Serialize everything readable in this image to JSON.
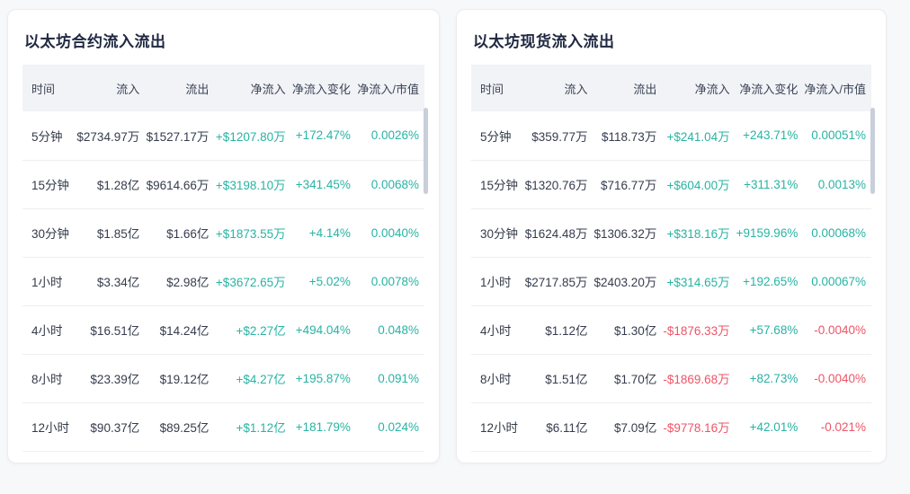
{
  "colors": {
    "positive": "#29b3a4",
    "negative": "#ee5467"
  },
  "tables": {
    "contract": {
      "title": "以太坊合约流入流出",
      "headers": {
        "time": "时间",
        "inflow": "流入",
        "outflow": "流出",
        "net": "净流入",
        "net_change": "净流入变化",
        "net_mcap": "净流入/市值"
      },
      "rows": [
        {
          "time": "5分钟",
          "inflow": "$2734.97万",
          "outflow": "$1527.17万",
          "net": "+$1207.80万",
          "net_class": "pos",
          "net_change": "+172.47%",
          "net_change_class": "pos",
          "net_mcap": "0.0026%",
          "net_mcap_class": "pos"
        },
        {
          "time": "15分钟",
          "inflow": "$1.28亿",
          "outflow": "$9614.66万",
          "net": "+$3198.10万",
          "net_class": "pos",
          "net_change": "+341.45%",
          "net_change_class": "pos",
          "net_mcap": "0.0068%",
          "net_mcap_class": "pos"
        },
        {
          "time": "30分钟",
          "inflow": "$1.85亿",
          "outflow": "$1.66亿",
          "net": "+$1873.55万",
          "net_class": "pos",
          "net_change": "+4.14%",
          "net_change_class": "pos",
          "net_mcap": "0.0040%",
          "net_mcap_class": "pos"
        },
        {
          "time": "1小时",
          "inflow": "$3.34亿",
          "outflow": "$2.98亿",
          "net": "+$3672.65万",
          "net_class": "pos",
          "net_change": "+5.02%",
          "net_change_class": "pos",
          "net_mcap": "0.0078%",
          "net_mcap_class": "pos"
        },
        {
          "time": "4小时",
          "inflow": "$16.51亿",
          "outflow": "$14.24亿",
          "net": "+$2.27亿",
          "net_class": "pos",
          "net_change": "+494.04%",
          "net_change_class": "pos",
          "net_mcap": "0.048%",
          "net_mcap_class": "pos"
        },
        {
          "time": "8小时",
          "inflow": "$23.39亿",
          "outflow": "$19.12亿",
          "net": "+$4.27亿",
          "net_class": "pos",
          "net_change": "+195.87%",
          "net_change_class": "pos",
          "net_mcap": "0.091%",
          "net_mcap_class": "pos"
        },
        {
          "time": "12小时",
          "inflow": "$90.37亿",
          "outflow": "$89.25亿",
          "net": "+$1.12亿",
          "net_class": "pos",
          "net_change": "+181.79%",
          "net_change_class": "pos",
          "net_mcap": "0.024%",
          "net_mcap_class": "pos"
        }
      ]
    },
    "spot": {
      "title": "以太坊现货流入流出",
      "headers": {
        "time": "时间",
        "inflow": "流入",
        "outflow": "流出",
        "net": "净流入",
        "net_change": "净流入变化",
        "net_mcap": "净流入/市值"
      },
      "rows": [
        {
          "time": "5分钟",
          "inflow": "$359.77万",
          "outflow": "$118.73万",
          "net": "+$241.04万",
          "net_class": "pos",
          "net_change": "+243.71%",
          "net_change_class": "pos",
          "net_mcap": "0.00051%",
          "net_mcap_class": "pos"
        },
        {
          "time": "15分钟",
          "inflow": "$1320.76万",
          "outflow": "$716.77万",
          "net": "+$604.00万",
          "net_class": "pos",
          "net_change": "+311.31%",
          "net_change_class": "pos",
          "net_mcap": "0.0013%",
          "net_mcap_class": "pos"
        },
        {
          "time": "30分钟",
          "inflow": "$1624.48万",
          "outflow": "$1306.32万",
          "net": "+$318.16万",
          "net_class": "pos",
          "net_change": "+9159.96%",
          "net_change_class": "pos",
          "net_mcap": "0.00068%",
          "net_mcap_class": "pos"
        },
        {
          "time": "1小时",
          "inflow": "$2717.85万",
          "outflow": "$2403.20万",
          "net": "+$314.65万",
          "net_class": "pos",
          "net_change": "+192.65%",
          "net_change_class": "pos",
          "net_mcap": "0.00067%",
          "net_mcap_class": "pos"
        },
        {
          "time": "4小时",
          "inflow": "$1.12亿",
          "outflow": "$1.30亿",
          "net": "-$1876.33万",
          "net_class": "neg",
          "net_change": "+57.68%",
          "net_change_class": "pos",
          "net_mcap": "-0.0040%",
          "net_mcap_class": "neg"
        },
        {
          "time": "8小时",
          "inflow": "$1.51亿",
          "outflow": "$1.70亿",
          "net": "-$1869.68万",
          "net_class": "neg",
          "net_change": "+82.73%",
          "net_change_class": "pos",
          "net_mcap": "-0.0040%",
          "net_mcap_class": "neg"
        },
        {
          "time": "12小时",
          "inflow": "$6.11亿",
          "outflow": "$7.09亿",
          "net": "-$9778.16万",
          "net_class": "neg",
          "net_change": "+42.01%",
          "net_change_class": "pos",
          "net_mcap": "-0.021%",
          "net_mcap_class": "neg"
        }
      ]
    }
  }
}
